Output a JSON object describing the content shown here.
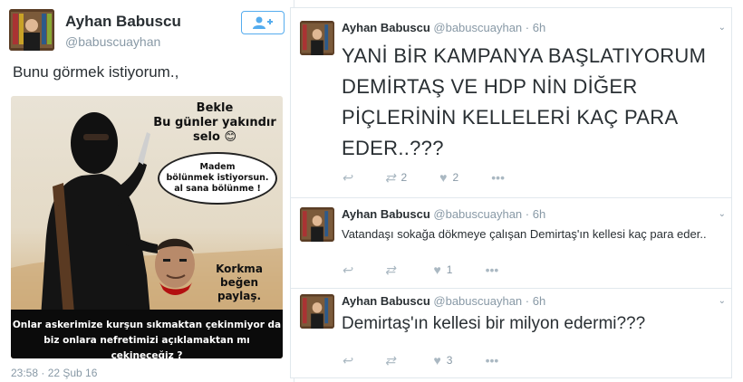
{
  "left_tweet": {
    "author_name": "Ayhan Babuscu",
    "author_handle": "@babuscuayhan",
    "follow_icon": "follow-user-icon",
    "text": "Bunu görmek istiyorum.,",
    "meme": {
      "top_text_lines": [
        "Bekle",
        "Bu günler yakındır",
        "selo 😊"
      ],
      "bubble_lines": [
        "Madem",
        "bölünmek istiyorsun.",
        "al sana bölünme !"
      ],
      "side_text_lines": [
        "Korkma",
        "beğen",
        "paylaş."
      ],
      "caption_lines": [
        "Onlar askerimize kurşun sıkmaktan çekinmiyor da",
        "biz onlara nefretimizi açıklamaktan mı çekineceğiz ?"
      ]
    },
    "timestamp": "23:58 · 22 Şub 16"
  },
  "timeline": {
    "tweets": [
      {
        "author_name": "Ayhan Babuscu",
        "author_handle": "@babuscuayhan",
        "time": "· 6h",
        "lines": [
          "YANİ BİR KAMPANYA BAŞLATIYORUM",
          "DEMİRTAŞ VE HDP NİN DİĞER",
          "PİÇLERİNİN KELLELERİ KAÇ PARA",
          "EDER..???"
        ],
        "retweets": "2",
        "likes": "2"
      },
      {
        "author_name": "Ayhan Babuscu",
        "author_handle": "@babuscuayhan",
        "time": "· 6h",
        "lines": [
          "Vatandaşı sokağa dökmeye çalışan Demirtaş'ın kellesi kaç para eder.."
        ],
        "retweets": "",
        "likes": "1"
      },
      {
        "author_name": "Ayhan Babuscu",
        "author_handle": "@babuscuayhan",
        "time": "· 6h",
        "lines": [
          "Demirtaş'ın kellesi bir milyon edermi???"
        ],
        "retweets": "",
        "likes": "3"
      }
    ],
    "icons": {
      "reply": "reply-icon",
      "retweet": "retweet-icon",
      "like": "heart-icon",
      "more": "more-dots-icon",
      "caret": "chevron-down-icon"
    }
  },
  "colors": {
    "accent": "#55acee",
    "text": "#292f33",
    "muted": "#8899a6"
  }
}
